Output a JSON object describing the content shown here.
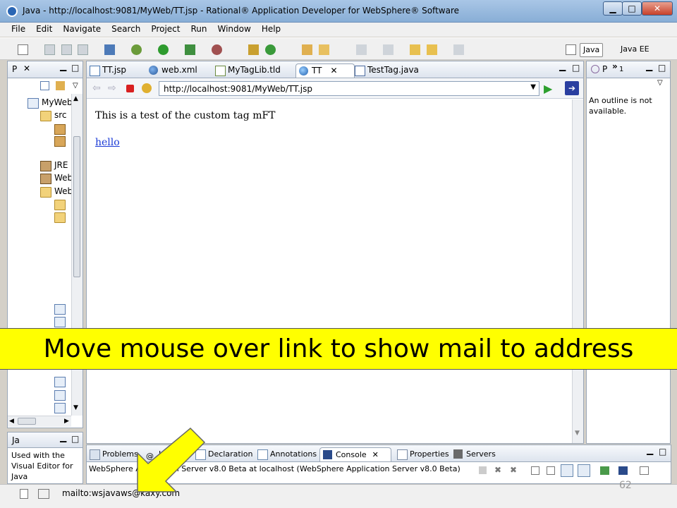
{
  "window": {
    "title": "Java - http://localhost:9081/MyWeb/TT.jsp - Rational® Application Developer for WebSphere® Software",
    "min_glyph": "▁",
    "max_glyph": "□",
    "close_glyph": "✕"
  },
  "menu": [
    "File",
    "Edit",
    "Navigate",
    "Search",
    "Project",
    "Run",
    "Window",
    "Help"
  ],
  "toolbar": {
    "perspectives": [
      "Java",
      "Java EE"
    ]
  },
  "left_view": {
    "tab_label": "P",
    "tree": [
      "MyWeb",
      "src",
      "JRE",
      "Web",
      "Web"
    ]
  },
  "editor": {
    "tabs": [
      "TT.jsp",
      "web.xml",
      "MyTagLib.tld",
      "TT",
      "TestTag.java"
    ],
    "active_tab": "TT",
    "url": "http://localhost:9081/MyWeb/TT.jsp",
    "page_text": "This is a test of the custom tag mFT",
    "link_text": "hello"
  },
  "outline": {
    "tab_label": "P",
    "overflow_count": "1",
    "message": "An outline is not available."
  },
  "bottom_left": {
    "tab_label": "Ja",
    "text": "Used with the Visual Editor for Java"
  },
  "bottom_tabs": [
    "Problems",
    "Ja",
    "Declaration",
    "Annotations",
    "Console",
    "Properties",
    "Servers"
  ],
  "console": {
    "server_line": "WebSphere Application Server v8.0 Beta at localhost (WebSphere Application Server v8.0 Beta)"
  },
  "status": {
    "text": "mailto:wsjavaws@kaxy.com"
  },
  "annotation": {
    "banner": "Move mouse over link to show mail to address",
    "slide_number": "62",
    "arrow_color": "#ffff00"
  },
  "colors": {
    "link": "#1a3ad6",
    "banner_bg": "#ffff00"
  }
}
